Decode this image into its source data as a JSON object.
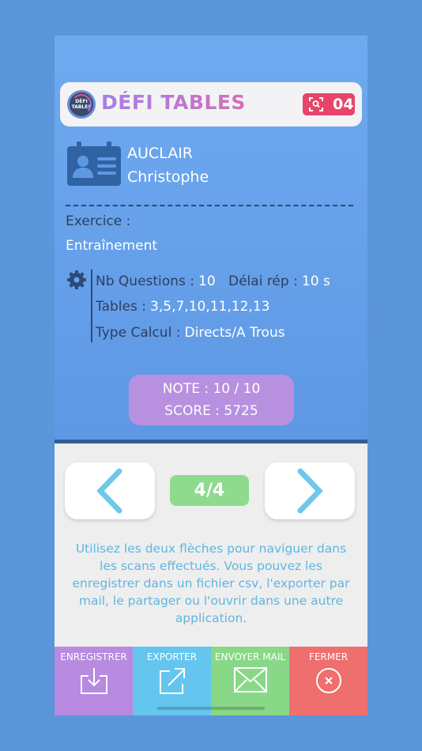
{
  "header": {
    "logo_line1": "DÉFI",
    "logo_line2": "TABLES",
    "title": "DÉFI TABLES",
    "scan_count": "04"
  },
  "student": {
    "last_name": "AUCLAIR",
    "first_name": "Christophe"
  },
  "exercise": {
    "label": "Exercice :",
    "value": "Entraînement"
  },
  "settings": {
    "questions_label": "Nb Questions :",
    "questions_value": "10",
    "delay_label": "Délai rép :",
    "delay_value": "10 s",
    "tables_label": "Tables :",
    "tables_value": "3,5,7,10,11,12,13",
    "calc_label": "Type Calcul :",
    "calc_value": "Directs/A Trous"
  },
  "result": {
    "note": "NOTE :  10 / 10",
    "score": "SCORE :   5725"
  },
  "navigation": {
    "counter": "4/4"
  },
  "help_text": "Utilisez les deux flèches pour naviguer dans les scans effectués.  Vous pouvez les enregistrer dans un fichier csv, l'exporter par mail, le partager ou l'ouvrir dans une autre application.",
  "actions": {
    "save": "ENREGISTRER",
    "export": "EXPORTER",
    "mail": "ENVOYER MAIL",
    "close": "FERMER"
  },
  "colors": {
    "background": "#5b95da",
    "title_gradient_start": "#a87ee8",
    "title_gradient_end": "#d070b8",
    "badge": "#e8446a",
    "score_box": "#b890e0",
    "counter": "#8fdb8e",
    "arrow": "#6ec8ea",
    "save": "#b88ae0",
    "export": "#64c6ee",
    "mail": "#88d888",
    "close": "#ef6e6e"
  },
  "icons": {
    "scan": "qr-scan-icon",
    "student": "id-card-icon",
    "settings": "gear-icon",
    "prev": "chevron-left-icon",
    "next": "chevron-right-icon",
    "save": "download-tray-icon",
    "export": "share-arrow-icon",
    "mail": "envelope-icon",
    "close": "close-circle-icon"
  }
}
